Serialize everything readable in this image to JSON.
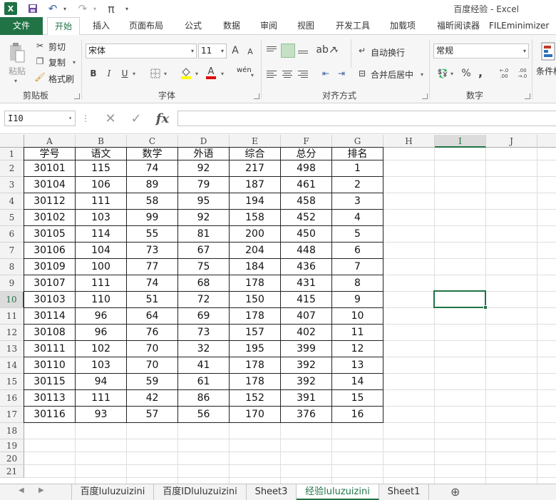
{
  "window": {
    "title": "百度经验 - Excel",
    "app_badge": "X"
  },
  "quick_access": {
    "save_glyph": "💾",
    "undo_glyph": "↶",
    "redo_glyph": "↷",
    "pi_glyph": "π",
    "more_glyph": "▾"
  },
  "tabs": [
    "文件",
    "开始",
    "插入",
    "页面布局",
    "公式",
    "数据",
    "审阅",
    "视图",
    "开发工具",
    "加载项",
    "福昕阅读器",
    "FILEminimizer"
  ],
  "ribbon": {
    "clipboard": {
      "paste": "粘贴",
      "cut": "剪切",
      "copy": "复制",
      "format_painter": "格式刷",
      "label": "剪贴板"
    },
    "font": {
      "font_name": "宋体",
      "font_size": "11",
      "grow": "A",
      "shrink": "A",
      "bold": "B",
      "italic": "I",
      "underline": "U",
      "phonetic": "wén",
      "font_color_glyph": "A",
      "label": "字体"
    },
    "alignment": {
      "wrap_text": "自动换行",
      "merge_center": "合并后居中",
      "label": "对齐方式"
    },
    "number": {
      "format": "常规",
      "percent": "%",
      "comma": ",",
      "increase_decimal": "←.0 .00",
      "decrease_decimal": ".00 →.0",
      "label": "数字"
    },
    "styles": {
      "conditional": "条件格"
    }
  },
  "formula_bar": {
    "name_box": "I10",
    "cancel": "✕",
    "enter": "✓",
    "fx": "fx"
  },
  "columns": [
    "A",
    "B",
    "C",
    "D",
    "E",
    "F",
    "G",
    "H",
    "I",
    "J"
  ],
  "rows": [
    "1",
    "2",
    "3",
    "4",
    "5",
    "6",
    "7",
    "8",
    "9",
    "10",
    "11",
    "12",
    "13",
    "14",
    "15",
    "16",
    "17",
    "18",
    "19",
    "20",
    "21"
  ],
  "table": {
    "headers": [
      "学号",
      "语文",
      "数学",
      "外语",
      "综合",
      "总分",
      "排名"
    ],
    "rows": [
      [
        "30101",
        "115",
        "74",
        "92",
        "217",
        "498",
        "1"
      ],
      [
        "30104",
        "106",
        "89",
        "79",
        "187",
        "461",
        "2"
      ],
      [
        "30112",
        "111",
        "58",
        "95",
        "194",
        "458",
        "3"
      ],
      [
        "30102",
        "103",
        "99",
        "92",
        "158",
        "452",
        "4"
      ],
      [
        "30105",
        "114",
        "55",
        "81",
        "200",
        "450",
        "5"
      ],
      [
        "30106",
        "104",
        "73",
        "67",
        "204",
        "448",
        "6"
      ],
      [
        "30109",
        "100",
        "77",
        "75",
        "184",
        "436",
        "7"
      ],
      [
        "30107",
        "111",
        "74",
        "68",
        "178",
        "431",
        "8"
      ],
      [
        "30103",
        "110",
        "51",
        "72",
        "150",
        "415",
        "9"
      ],
      [
        "30114",
        "96",
        "64",
        "69",
        "178",
        "407",
        "10"
      ],
      [
        "30108",
        "96",
        "76",
        "73",
        "157",
        "402",
        "11"
      ],
      [
        "30111",
        "102",
        "70",
        "32",
        "195",
        "399",
        "12"
      ],
      [
        "30110",
        "103",
        "70",
        "41",
        "178",
        "392",
        "13"
      ],
      [
        "30115",
        "94",
        "59",
        "61",
        "178",
        "392",
        "14"
      ],
      [
        "30113",
        "111",
        "42",
        "86",
        "152",
        "391",
        "15"
      ],
      [
        "30116",
        "93",
        "57",
        "56",
        "170",
        "376",
        "16"
      ]
    ]
  },
  "selected": {
    "column": "I",
    "row": "10"
  },
  "sheets": [
    "百度luluzuizini",
    "百度IDluluzuizini",
    "Sheet3",
    "经验luluzuizini",
    "Sheet1"
  ],
  "active_sheet": "经验luluzuizini",
  "add_sheet": "⊕",
  "colors": {
    "accent": "#217346",
    "header_bg": "#f3f3f3"
  }
}
